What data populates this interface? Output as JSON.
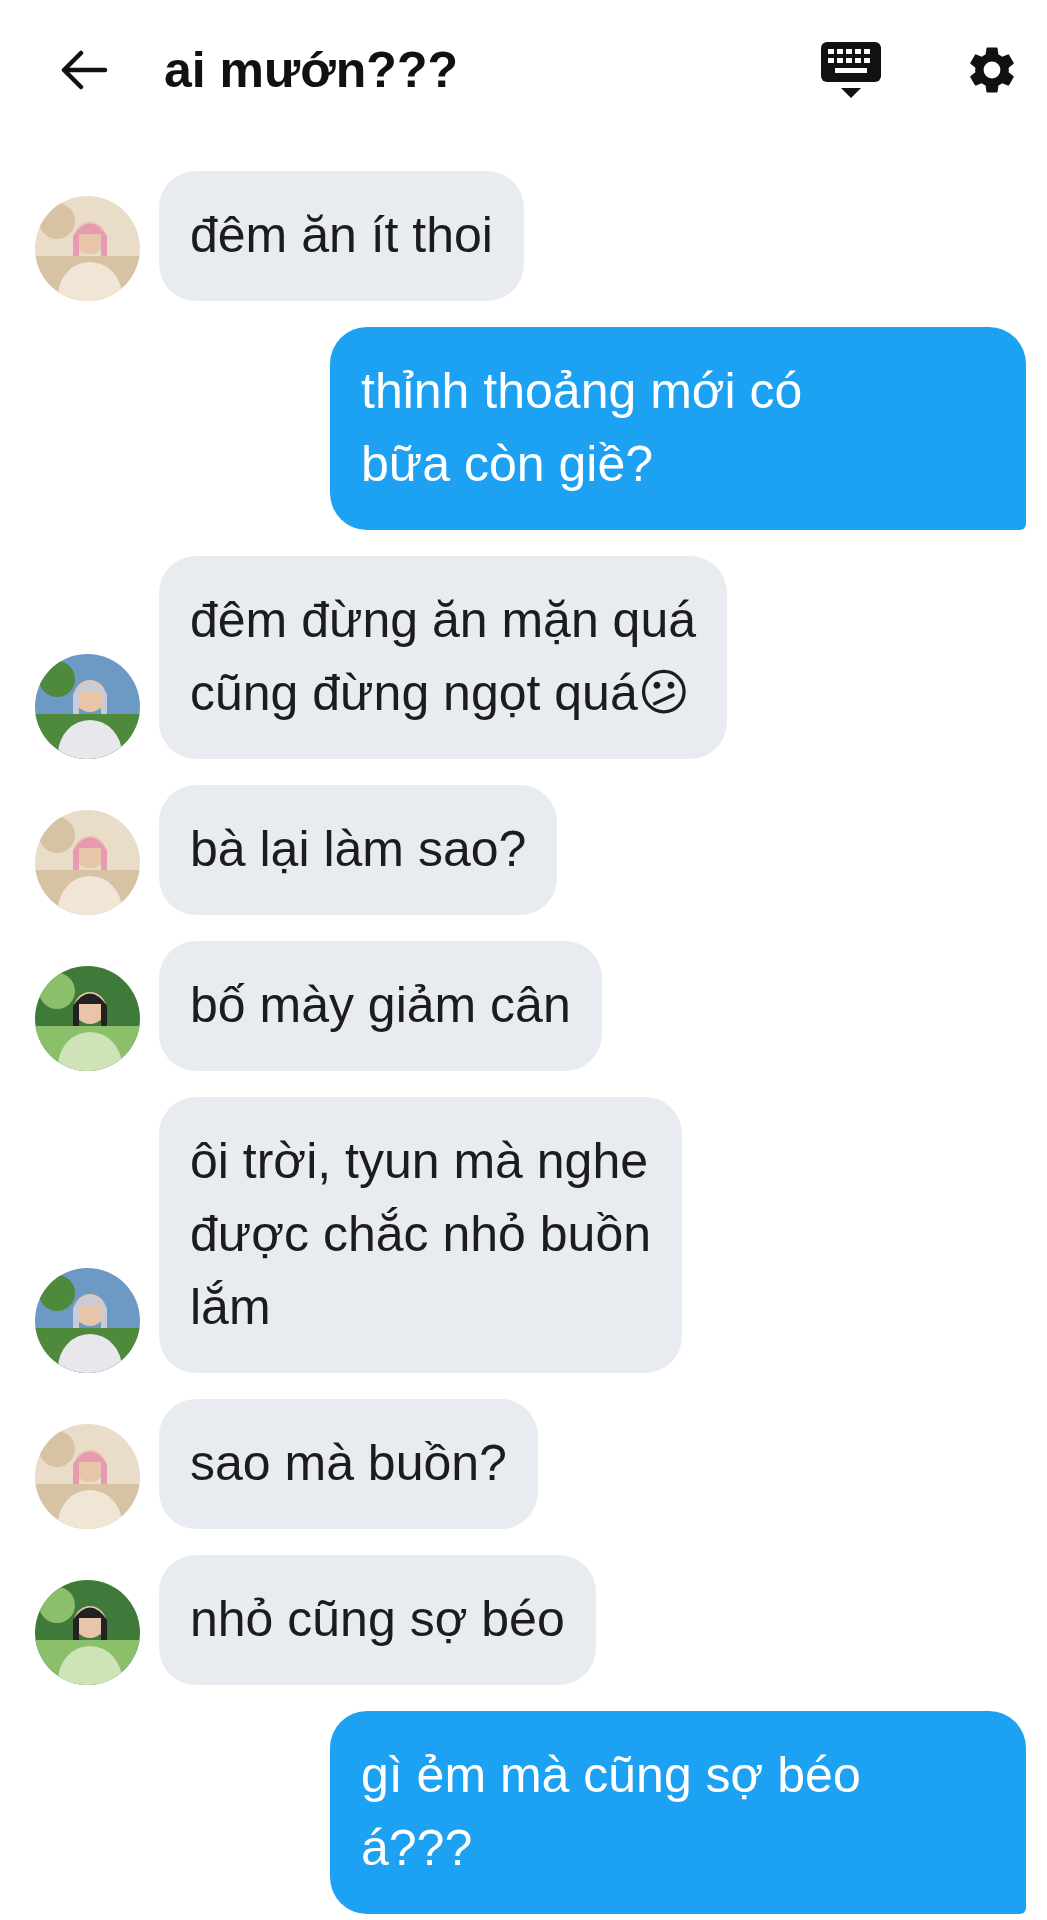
{
  "header": {
    "title": "ai mướn???"
  },
  "messages": [
    {
      "kind": "received",
      "text": "đêm ăn ít thoi"
    },
    {
      "kind": "sent",
      "text": "thỉnh thoảng mới có\nbữa còn giề?"
    },
    {
      "kind": "received",
      "text": "đêm đừng ăn mặn quá\ncũng đừng ngọt quá😕"
    },
    {
      "kind": "received",
      "text": "bà lại làm sao?"
    },
    {
      "kind": "received",
      "text": "bố mày giảm cân"
    },
    {
      "kind": "received",
      "text": "ôi trời, tyun mà nghe\nđược chắc nhỏ buồn\nlắm"
    },
    {
      "kind": "received",
      "text": "sao mà buồn?"
    },
    {
      "kind": "received",
      "text": "nhỏ cũng sợ béo"
    },
    {
      "kind": "sent",
      "text": "gì ẻm mà cũng sợ béo\ná???"
    }
  ]
}
